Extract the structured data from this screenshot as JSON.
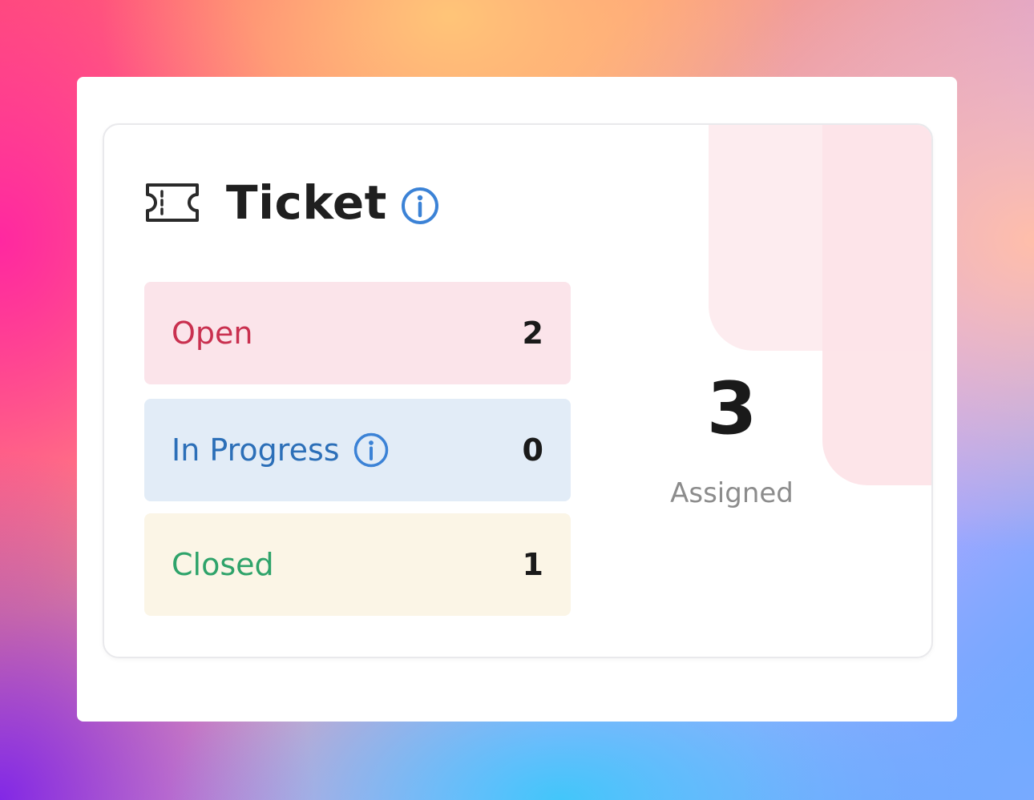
{
  "card": {
    "title": "Ticket",
    "icons": {
      "title_icon": "ticket-icon",
      "title_info": "info-icon",
      "row_info": "info-icon"
    }
  },
  "statuses": [
    {
      "label": "Open",
      "count": "2",
      "color": "#c9304f",
      "background": "#fbe4ea"
    },
    {
      "label": "In Progress",
      "count": "0",
      "color": "#2c6fb8",
      "background": "#e2ecf7"
    },
    {
      "label": "Closed",
      "count": "1",
      "color": "#2ea36a",
      "background": "#fbf5e6"
    }
  ],
  "assigned": {
    "count": "3",
    "label": "Assigned"
  },
  "colors": {
    "accent_blue": "#3b82d6",
    "decor_pink": "#fdecef"
  }
}
